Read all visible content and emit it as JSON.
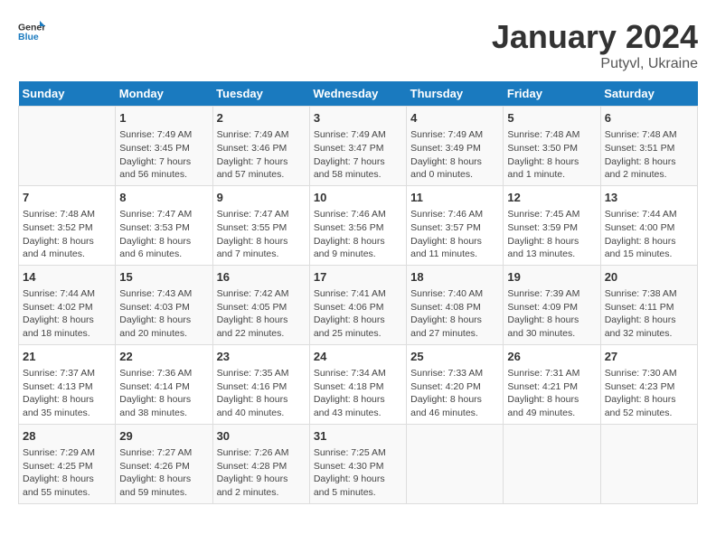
{
  "header": {
    "logo_general": "General",
    "logo_blue": "Blue",
    "month_title": "January 2024",
    "location": "Putyvl, Ukraine"
  },
  "weekdays": [
    "Sunday",
    "Monday",
    "Tuesday",
    "Wednesday",
    "Thursday",
    "Friday",
    "Saturday"
  ],
  "rows": [
    [
      {
        "day": "",
        "info": ""
      },
      {
        "day": "1",
        "info": "Sunrise: 7:49 AM\nSunset: 3:45 PM\nDaylight: 7 hours\nand 56 minutes."
      },
      {
        "day": "2",
        "info": "Sunrise: 7:49 AM\nSunset: 3:46 PM\nDaylight: 7 hours\nand 57 minutes."
      },
      {
        "day": "3",
        "info": "Sunrise: 7:49 AM\nSunset: 3:47 PM\nDaylight: 7 hours\nand 58 minutes."
      },
      {
        "day": "4",
        "info": "Sunrise: 7:49 AM\nSunset: 3:49 PM\nDaylight: 8 hours\nand 0 minutes."
      },
      {
        "day": "5",
        "info": "Sunrise: 7:48 AM\nSunset: 3:50 PM\nDaylight: 8 hours\nand 1 minute."
      },
      {
        "day": "6",
        "info": "Sunrise: 7:48 AM\nSunset: 3:51 PM\nDaylight: 8 hours\nand 2 minutes."
      }
    ],
    [
      {
        "day": "7",
        "info": "Sunrise: 7:48 AM\nSunset: 3:52 PM\nDaylight: 8 hours\nand 4 minutes."
      },
      {
        "day": "8",
        "info": "Sunrise: 7:47 AM\nSunset: 3:53 PM\nDaylight: 8 hours\nand 6 minutes."
      },
      {
        "day": "9",
        "info": "Sunrise: 7:47 AM\nSunset: 3:55 PM\nDaylight: 8 hours\nand 7 minutes."
      },
      {
        "day": "10",
        "info": "Sunrise: 7:46 AM\nSunset: 3:56 PM\nDaylight: 8 hours\nand 9 minutes."
      },
      {
        "day": "11",
        "info": "Sunrise: 7:46 AM\nSunset: 3:57 PM\nDaylight: 8 hours\nand 11 minutes."
      },
      {
        "day": "12",
        "info": "Sunrise: 7:45 AM\nSunset: 3:59 PM\nDaylight: 8 hours\nand 13 minutes."
      },
      {
        "day": "13",
        "info": "Sunrise: 7:44 AM\nSunset: 4:00 PM\nDaylight: 8 hours\nand 15 minutes."
      }
    ],
    [
      {
        "day": "14",
        "info": "Sunrise: 7:44 AM\nSunset: 4:02 PM\nDaylight: 8 hours\nand 18 minutes."
      },
      {
        "day": "15",
        "info": "Sunrise: 7:43 AM\nSunset: 4:03 PM\nDaylight: 8 hours\nand 20 minutes."
      },
      {
        "day": "16",
        "info": "Sunrise: 7:42 AM\nSunset: 4:05 PM\nDaylight: 8 hours\nand 22 minutes."
      },
      {
        "day": "17",
        "info": "Sunrise: 7:41 AM\nSunset: 4:06 PM\nDaylight: 8 hours\nand 25 minutes."
      },
      {
        "day": "18",
        "info": "Sunrise: 7:40 AM\nSunset: 4:08 PM\nDaylight: 8 hours\nand 27 minutes."
      },
      {
        "day": "19",
        "info": "Sunrise: 7:39 AM\nSunset: 4:09 PM\nDaylight: 8 hours\nand 30 minutes."
      },
      {
        "day": "20",
        "info": "Sunrise: 7:38 AM\nSunset: 4:11 PM\nDaylight: 8 hours\nand 32 minutes."
      }
    ],
    [
      {
        "day": "21",
        "info": "Sunrise: 7:37 AM\nSunset: 4:13 PM\nDaylight: 8 hours\nand 35 minutes."
      },
      {
        "day": "22",
        "info": "Sunrise: 7:36 AM\nSunset: 4:14 PM\nDaylight: 8 hours\nand 38 minutes."
      },
      {
        "day": "23",
        "info": "Sunrise: 7:35 AM\nSunset: 4:16 PM\nDaylight: 8 hours\nand 40 minutes."
      },
      {
        "day": "24",
        "info": "Sunrise: 7:34 AM\nSunset: 4:18 PM\nDaylight: 8 hours\nand 43 minutes."
      },
      {
        "day": "25",
        "info": "Sunrise: 7:33 AM\nSunset: 4:20 PM\nDaylight: 8 hours\nand 46 minutes."
      },
      {
        "day": "26",
        "info": "Sunrise: 7:31 AM\nSunset: 4:21 PM\nDaylight: 8 hours\nand 49 minutes."
      },
      {
        "day": "27",
        "info": "Sunrise: 7:30 AM\nSunset: 4:23 PM\nDaylight: 8 hours\nand 52 minutes."
      }
    ],
    [
      {
        "day": "28",
        "info": "Sunrise: 7:29 AM\nSunset: 4:25 PM\nDaylight: 8 hours\nand 55 minutes."
      },
      {
        "day": "29",
        "info": "Sunrise: 7:27 AM\nSunset: 4:26 PM\nDaylight: 8 hours\nand 59 minutes."
      },
      {
        "day": "30",
        "info": "Sunrise: 7:26 AM\nSunset: 4:28 PM\nDaylight: 9 hours\nand 2 minutes."
      },
      {
        "day": "31",
        "info": "Sunrise: 7:25 AM\nSunset: 4:30 PM\nDaylight: 9 hours\nand 5 minutes."
      },
      {
        "day": "",
        "info": ""
      },
      {
        "day": "",
        "info": ""
      },
      {
        "day": "",
        "info": ""
      }
    ]
  ]
}
